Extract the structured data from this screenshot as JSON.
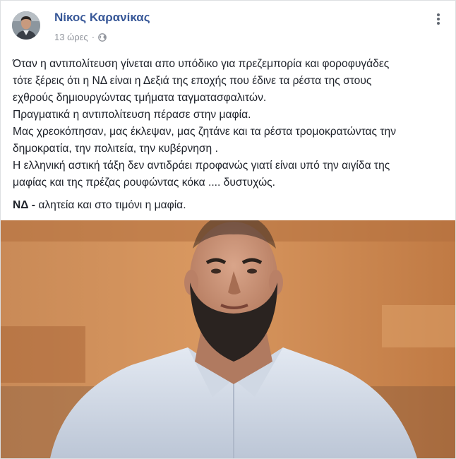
{
  "post": {
    "author_name": "Νίκος Καρανίκας",
    "time_ago": "13 ώρες",
    "separator": "·",
    "privacy_icon": "globe-icon",
    "more_icon": "more-options-icon",
    "lines": [
      "Όταν η αντιπολίτευση γίνεται απο υπόδικο για πρεζεμπορία και φοροφυγάδες",
      "τότε ξέρεις ότι η ΝΔ είναι η Δεξιά της εποχής που έδινε τα ρέστα της στους",
      "εχθρούς δημιουργώντας τμήματα ταγματασφαλιτών.",
      "Πραγματικά η αντιπολίτευση πέρασε στην μαφία.",
      "Μας χρεοκόπησαν, μας έκλεψαν, μας ζητάνε και τα ρέστα τρομοκρατώντας την",
      "δημοκρατία, την πολιτεία, την κυβέρνηση .",
      "Η ελληνική αστική τάξη δεν αντιδράει προφανώς γιατί είναι υπό την αιγίδα της",
      "μαφίας και της πρέζας ρουφώντας κόκα .... δυστυχώς."
    ],
    "last_line_bold": "ΝΔ -",
    "last_line_rest": " αλητεία και στο τιμόνι η μαφία."
  },
  "colors": {
    "name_link": "#385898",
    "meta_gray": "#90949c",
    "text": "#1d2129",
    "border": "#dddfe2"
  }
}
